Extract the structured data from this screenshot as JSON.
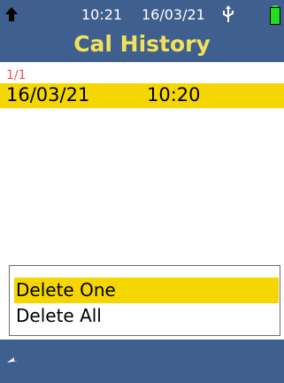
{
  "status_bar": {
    "time": "10:21",
    "date": "16/03/21",
    "icons": [
      "up-arrow-icon",
      "usb-icon",
      "battery-icon"
    ]
  },
  "header": {
    "title": "Cal History"
  },
  "list": {
    "page_indicator": "1/1",
    "entries": [
      {
        "date": "16/03/21",
        "time": "10:20",
        "selected": true
      }
    ]
  },
  "menu": {
    "items": [
      {
        "label": "Delete One",
        "selected": true
      },
      {
        "label": "Delete All",
        "selected": false
      }
    ]
  },
  "footer": {
    "icon": "back-icon"
  },
  "colors": {
    "bar_background": "#3f5f8f",
    "title": "#f2e15a",
    "highlight": "#f5d600",
    "page_indicator": "#e65555",
    "battery": "#22dd22"
  }
}
